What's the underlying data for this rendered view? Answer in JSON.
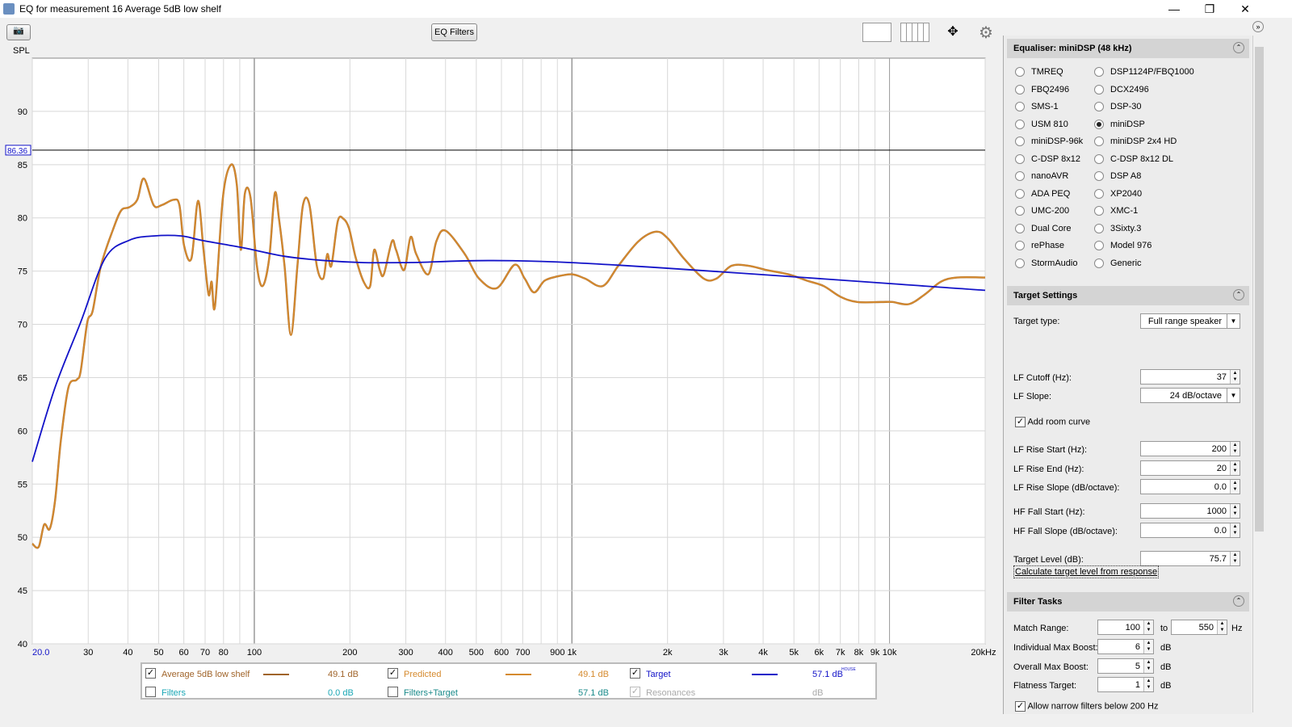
{
  "window": {
    "title": "EQ for measurement 16 Average 5dB low shelf",
    "minimize": "—",
    "maximize": "❐",
    "close": "✕"
  },
  "toolbar": {
    "spl_label": "SPL",
    "eq_filters": "EQ Filters",
    "icons": [
      "camera-icon",
      "legend-layout-icon",
      "columns-icon",
      "pan-arrows-icon",
      "gear-icon"
    ]
  },
  "colors": {
    "measurement": "#a0642a",
    "predicted": "#d58a2e",
    "target": "#1212c8",
    "filters": "#1aa7b5",
    "filters_target": "#1a8a8a"
  },
  "chart_data": {
    "type": "line",
    "xscale": "log",
    "xlim": [
      20,
      20000
    ],
    "ylim": [
      40,
      95
    ],
    "grid": true,
    "yticks": [
      40,
      45,
      50,
      55,
      60,
      65,
      70,
      75,
      80,
      85,
      90
    ],
    "xticks": [
      {
        "v": 20,
        "l": "20.0"
      },
      {
        "v": 30,
        "l": "30"
      },
      {
        "v": 40,
        "l": "40"
      },
      {
        "v": 50,
        "l": "50"
      },
      {
        "v": 60,
        "l": "60"
      },
      {
        "v": 70,
        "l": "70"
      },
      {
        "v": 80,
        "l": "80"
      },
      {
        "v": 100,
        "l": "100"
      },
      {
        "v": 200,
        "l": "200"
      },
      {
        "v": 300,
        "l": "300"
      },
      {
        "v": 400,
        "l": "400"
      },
      {
        "v": 500,
        "l": "500"
      },
      {
        "v": 600,
        "l": "600"
      },
      {
        "v": 700,
        "l": "700"
      },
      {
        "v": 900,
        "l": "900"
      },
      {
        "v": 1000,
        "l": "1k"
      },
      {
        "v": 2000,
        "l": "2k"
      },
      {
        "v": 3000,
        "l": "3k"
      },
      {
        "v": 4000,
        "l": "4k"
      },
      {
        "v": 5000,
        "l": "5k"
      },
      {
        "v": 6000,
        "l": "6k"
      },
      {
        "v": 7000,
        "l": "7k"
      },
      {
        "v": 8000,
        "l": "8k"
      },
      {
        "v": 9000,
        "l": "9k"
      },
      {
        "v": 10000,
        "l": "10k"
      },
      {
        "v": 20000,
        "l": "20kHz"
      }
    ],
    "cursor_value": 86.36,
    "cursor_label": "86.36",
    "ylabel": "SPL",
    "series": [
      {
        "name": "Average 5dB low shelf",
        "key": "measurement",
        "points": [
          [
            20,
            49.4
          ],
          [
            20.95,
            49.1
          ],
          [
            21.8,
            51.2
          ],
          [
            22.7,
            50.8
          ],
          [
            23.6,
            53.5
          ],
          [
            24.6,
            59.1
          ],
          [
            26,
            64.1
          ],
          [
            27.6,
            64.8
          ],
          [
            28.4,
            65.6
          ],
          [
            29.8,
            70.2
          ],
          [
            31,
            71.3
          ],
          [
            32.9,
            75.5
          ],
          [
            35.9,
            78.9
          ],
          [
            38.1,
            80.7
          ],
          [
            40.4,
            81
          ],
          [
            42.8,
            81.7
          ],
          [
            44.9,
            83.7
          ],
          [
            48.2,
            81.2
          ],
          [
            51.1,
            81.2
          ],
          [
            55.7,
            81.7
          ],
          [
            58.1,
            81.2
          ],
          [
            60.1,
            77.4
          ],
          [
            63.4,
            76.2
          ],
          [
            66.5,
            81.6
          ],
          [
            69.2,
            77
          ],
          [
            71.8,
            72.8
          ],
          [
            73.4,
            74
          ],
          [
            75.2,
            71.7
          ],
          [
            79.7,
            82
          ],
          [
            84.5,
            85
          ],
          [
            88.1,
            83.1
          ],
          [
            90.7,
            77
          ],
          [
            93.4,
            82.3
          ],
          [
            97.3,
            81.9
          ],
          [
            101.9,
            75.5
          ],
          [
            106.2,
            73.6
          ],
          [
            111.4,
            76.2
          ],
          [
            116,
            82.3
          ],
          [
            119.5,
            80
          ],
          [
            124.5,
            75.5
          ],
          [
            130.4,
            69
          ],
          [
            136.7,
            75.5
          ],
          [
            142.3,
            81.2
          ],
          [
            149.2,
            81.2
          ],
          [
            157.3,
            75.5
          ],
          [
            164.8,
            74.3
          ],
          [
            169.8,
            76.6
          ],
          [
            174.8,
            75.5
          ],
          [
            183.2,
            79.7
          ],
          [
            191,
            79.9
          ],
          [
            198.8,
            79
          ],
          [
            208.4,
            76.3
          ],
          [
            221,
            74
          ],
          [
            231.6,
            73.6
          ],
          [
            238.5,
            77
          ],
          [
            248.4,
            75.1
          ],
          [
            255.8,
            74.7
          ],
          [
            271.2,
            77.8
          ],
          [
            279.4,
            77
          ],
          [
            296.2,
            75.1
          ],
          [
            310.5,
            78.2
          ],
          [
            323.4,
            76.6
          ],
          [
            353,
            74.7
          ],
          [
            374.3,
            77.8
          ],
          [
            400,
            78.8
          ],
          [
            460,
            76.6
          ],
          [
            510,
            74.3
          ],
          [
            580,
            73.4
          ],
          [
            660,
            75.6
          ],
          [
            710,
            74.3
          ],
          [
            760,
            73
          ],
          [
            820,
            74.1
          ],
          [
            900,
            74.5
          ],
          [
            1000,
            74.7
          ],
          [
            1100,
            74.3
          ],
          [
            1250,
            73.6
          ],
          [
            1400,
            75.5
          ],
          [
            1620,
            77.8
          ],
          [
            1840,
            78.7
          ],
          [
            2000,
            78.1
          ],
          [
            2250,
            76.2
          ],
          [
            2600,
            74.3
          ],
          [
            2850,
            74.3
          ],
          [
            3180,
            75.5
          ],
          [
            3600,
            75.5
          ],
          [
            4100,
            75.1
          ],
          [
            4800,
            74.7
          ],
          [
            5500,
            74.1
          ],
          [
            6200,
            73.6
          ],
          [
            7000,
            72.6
          ],
          [
            7900,
            72.1
          ],
          [
            9400,
            72.1
          ],
          [
            10200,
            72.1
          ],
          [
            11500,
            71.9
          ],
          [
            12900,
            72.8
          ],
          [
            14500,
            74
          ],
          [
            16300,
            74.4
          ],
          [
            20000,
            74.4
          ]
        ],
        "legend_value": "49.1 dB"
      },
      {
        "name": "Predicted",
        "key": "predicted",
        "same_as": "Average 5dB low shelf",
        "legend_value": "49.1 dB"
      },
      {
        "name": "Target",
        "key": "target",
        "points": [
          [
            20,
            57.1
          ],
          [
            23.6,
            64.1
          ],
          [
            28.4,
            70.2
          ],
          [
            33.9,
            76.2
          ],
          [
            40.4,
            77.9
          ],
          [
            48.2,
            78.3
          ],
          [
            59,
            78.3
          ],
          [
            68,
            77.9
          ],
          [
            92,
            77.2
          ],
          [
            124,
            76.4
          ],
          [
            165,
            76
          ],
          [
            221,
            75.8
          ],
          [
            296,
            75.8
          ],
          [
            1000,
            75.8
          ],
          [
            20000,
            73.2
          ]
        ],
        "legend_value": "57.1 dB",
        "legend_sup": "HOUSE"
      }
    ]
  },
  "legend": {
    "rows": [
      [
        {
          "label": "Average 5dB low shelf",
          "checked": true,
          "value": "49.1 dB",
          "color": "#a0642a"
        },
        {
          "label": "Predicted",
          "checked": true,
          "value": "49.1 dB",
          "color": "#d58a2e"
        },
        {
          "label": "Target",
          "checked": true,
          "value": "57.1 dB",
          "color": "#1212c8",
          "sup": "HOUSE"
        }
      ],
      [
        {
          "label": "Filters",
          "checked": false,
          "value": "0.0 dB",
          "color": "#1aa7b5"
        },
        {
          "label": "Filters+Target",
          "checked": false,
          "value": "57.1 dB",
          "color": "#1a8a8a"
        },
        {
          "label": "Resonances",
          "checked": true,
          "value": "dB",
          "color": "#aaaaaa",
          "disabled": true
        }
      ]
    ]
  },
  "equaliser": {
    "title": "Equaliser: miniDSP (48 kHz)",
    "col1": [
      "TMREQ",
      "FBQ2496",
      "SMS-1",
      "USM 810",
      "miniDSP-96k",
      "C-DSP 8x12",
      "nanoAVR",
      "ADA PEQ",
      "UMC-200",
      "Dual Core",
      "rePhase",
      "StormAudio"
    ],
    "col2": [
      "DSP1124P/FBQ1000",
      "DCX2496",
      "DSP-30",
      "miniDSP",
      "miniDSP 2x4 HD",
      "C-DSP 8x12 DL",
      "DSP A8",
      "XP2040",
      "XMC-1",
      "3Sixty.3",
      "Model 976",
      "Generic"
    ],
    "selected": "miniDSP"
  },
  "target_settings": {
    "title": "Target Settings",
    "target_type_label": "Target type:",
    "target_type": "Full range speaker",
    "lf_cutoff_label": "LF Cutoff (Hz):",
    "lf_cutoff": "37",
    "lf_slope_label": "LF Slope:",
    "lf_slope": "24 dB/octave",
    "add_room_curve": "Add room curve",
    "add_room_curve_checked": true,
    "lf_rise_start_label": "LF Rise Start (Hz):",
    "lf_rise_start": "200",
    "lf_rise_end_label": "LF Rise End (Hz):",
    "lf_rise_end": "20",
    "lf_rise_slope_label": "LF Rise Slope (dB/octave):",
    "lf_rise_slope": "0.0",
    "hf_fall_start_label": "HF Fall Start (Hz):",
    "hf_fall_start": "1000",
    "hf_fall_slope_label": "HF Fall Slope (dB/octave):",
    "hf_fall_slope": "0.0",
    "target_level_label": "Target Level (dB):",
    "target_level": "75.7",
    "calc_button": "Calculate target level from response"
  },
  "filter_tasks": {
    "title": "Filter Tasks",
    "match_range_label": "Match Range:",
    "match_from": "100",
    "to": "to",
    "match_to": "550",
    "hz": "Hz",
    "ind_boost_label": "Individual Max Boost:",
    "ind_boost": "6",
    "overall_boost_label": "Overall Max Boost:",
    "overall_boost": "5",
    "flatness_label": "Flatness Target:",
    "flatness": "1",
    "db": "dB",
    "narrow": "Allow narrow filters below 200 Hz"
  }
}
